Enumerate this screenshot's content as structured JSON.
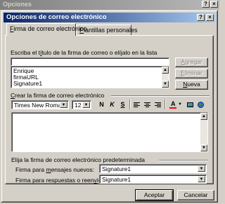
{
  "background_window": {
    "title": "Opciones"
  },
  "dialog": {
    "title": "Opciones de correo electrónico",
    "help_glyph": "?",
    "close_glyph": "×"
  },
  "tabs": [
    {
      "accel": "F",
      "rest": "irma de correo electrónico",
      "active": true
    },
    {
      "accel": "P",
      "rest": "lantillas personales",
      "active": false
    }
  ],
  "signature_section": {
    "label_pre": "Escriba el t",
    "label_accel": "í",
    "label_post": "tulo de la firma de correo o elíjalo en la lista",
    "name_input_value": "",
    "signatures": [
      "Enrique",
      "firmaURL",
      "Signature1"
    ],
    "buttons": {
      "add": {
        "accel": "A",
        "rest": "gregar"
      },
      "delete": {
        "accel": "E",
        "rest": "liminar"
      },
      "new": {
        "accel": "N",
        "rest": "ueva"
      }
    }
  },
  "editor_section": {
    "label_accel": "C",
    "label_rest": "rear la firma de correo electrónico",
    "font_name": "Times New Roman",
    "font_size": "12",
    "bold_glyph": "N",
    "italic_glyph": "K",
    "underline_glyph": "S",
    "font_color_glyph": "A",
    "body_text": ""
  },
  "default_section": {
    "label": "Elija la firma de correo electrónico predeterminada",
    "new_messages_label_pre": "Firma para ",
    "new_messages_label_accel": "m",
    "new_messages_label_post": "ensajes nuevos:",
    "new_messages_value": "Signature1",
    "replies_label_pre": "Firma para respuestas o reen",
    "replies_label_accel": "v",
    "replies_label_post": "íos:",
    "replies_value": "Signature1"
  },
  "footer": {
    "ok_label": "Aceptar",
    "cancel_label": "Cancelar"
  },
  "colors": {
    "title_active": "#0a246a",
    "title_active_end": "#a6caf0",
    "face": "#d4d0c8",
    "font_color_bar": "#ff0000"
  }
}
